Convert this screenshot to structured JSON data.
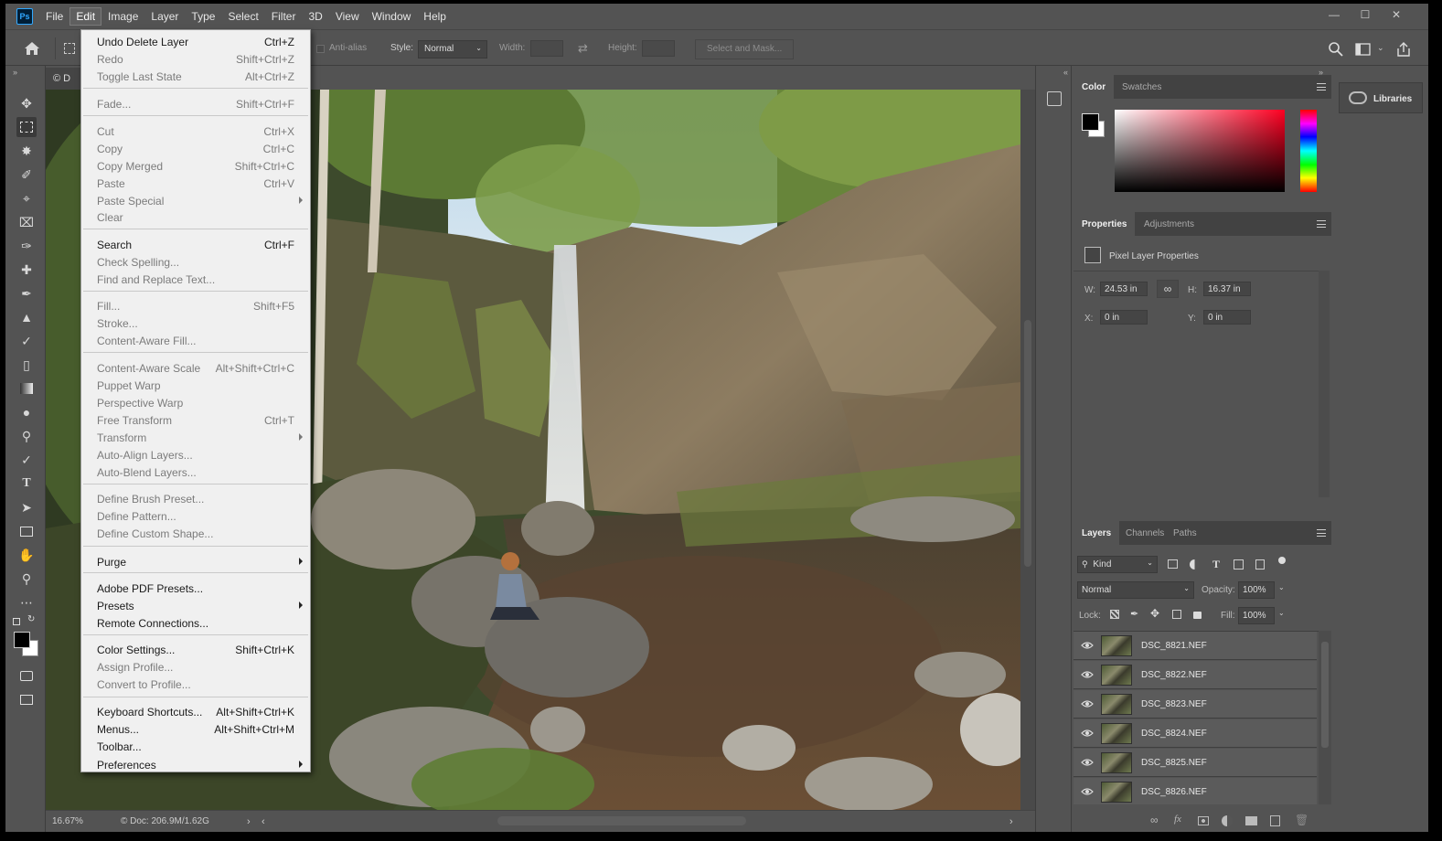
{
  "app": {
    "logo": "Ps"
  },
  "menubar": {
    "items": [
      "File",
      "Edit",
      "Image",
      "Layer",
      "Type",
      "Select",
      "Filter",
      "3D",
      "View",
      "Window",
      "Help"
    ],
    "active": "Edit"
  },
  "window_controls": [
    "minimize-icon",
    "maximize-icon",
    "close-icon"
  ],
  "options_bar": {
    "anti_alias": "Anti-alias",
    "style_label": "Style:",
    "style_value": "Normal",
    "width_label": "Width:",
    "height_label": "Height:",
    "select_mask": "Select and Mask..."
  },
  "document": {
    "tab_label": "© D"
  },
  "status": {
    "zoom": "16.67%",
    "doc": "© Doc: 206.9M/1.62G"
  },
  "edit_menu": {
    "items": [
      {
        "label": "Undo Delete Layer",
        "shortcut": "Ctrl+Z",
        "enabled": true
      },
      {
        "label": "Redo",
        "shortcut": "Shift+Ctrl+Z",
        "enabled": false
      },
      {
        "label": "Toggle Last State",
        "shortcut": "Alt+Ctrl+Z",
        "enabled": false
      },
      {
        "label": "Fade...",
        "shortcut": "Shift+Ctrl+F",
        "enabled": false
      },
      {
        "label": "Cut",
        "shortcut": "Ctrl+X",
        "enabled": false
      },
      {
        "label": "Copy",
        "shortcut": "Ctrl+C",
        "enabled": false
      },
      {
        "label": "Copy Merged",
        "shortcut": "Shift+Ctrl+C",
        "enabled": false
      },
      {
        "label": "Paste",
        "shortcut": "Ctrl+V",
        "enabled": false
      },
      {
        "label": "Paste Special",
        "shortcut": "",
        "enabled": false,
        "submenu": true
      },
      {
        "label": "Clear",
        "shortcut": "",
        "enabled": false
      },
      {
        "label": "Search",
        "shortcut": "Ctrl+F",
        "enabled": true
      },
      {
        "label": "Check Spelling...",
        "shortcut": "",
        "enabled": false
      },
      {
        "label": "Find and Replace Text...",
        "shortcut": "",
        "enabled": false
      },
      {
        "label": "Fill...",
        "shortcut": "Shift+F5",
        "enabled": false
      },
      {
        "label": "Stroke...",
        "shortcut": "",
        "enabled": false
      },
      {
        "label": "Content-Aware Fill...",
        "shortcut": "",
        "enabled": false
      },
      {
        "label": "Content-Aware Scale",
        "shortcut": "Alt+Shift+Ctrl+C",
        "enabled": false
      },
      {
        "label": "Puppet Warp",
        "shortcut": "",
        "enabled": false
      },
      {
        "label": "Perspective Warp",
        "shortcut": "",
        "enabled": false
      },
      {
        "label": "Free Transform",
        "shortcut": "Ctrl+T",
        "enabled": false
      },
      {
        "label": "Transform",
        "shortcut": "",
        "enabled": false,
        "submenu": true
      },
      {
        "label": "Auto-Align Layers...",
        "shortcut": "",
        "enabled": false
      },
      {
        "label": "Auto-Blend Layers...",
        "shortcut": "",
        "enabled": false
      },
      {
        "label": "Define Brush Preset...",
        "shortcut": "",
        "enabled": false
      },
      {
        "label": "Define Pattern...",
        "shortcut": "",
        "enabled": false
      },
      {
        "label": "Define Custom Shape...",
        "shortcut": "",
        "enabled": false
      },
      {
        "label": "Purge",
        "shortcut": "",
        "enabled": true,
        "submenu": true
      },
      {
        "label": "Adobe PDF Presets...",
        "shortcut": "",
        "enabled": true
      },
      {
        "label": "Presets",
        "shortcut": "",
        "enabled": true,
        "submenu": true
      },
      {
        "label": "Remote Connections...",
        "shortcut": "",
        "enabled": true
      },
      {
        "label": "Color Settings...",
        "shortcut": "Shift+Ctrl+K",
        "enabled": true
      },
      {
        "label": "Assign Profile...",
        "shortcut": "",
        "enabled": false
      },
      {
        "label": "Convert to Profile...",
        "shortcut": "",
        "enabled": false
      },
      {
        "label": "Keyboard Shortcuts...",
        "shortcut": "Alt+Shift+Ctrl+K",
        "enabled": true
      },
      {
        "label": "Menus...",
        "shortcut": "Alt+Shift+Ctrl+M",
        "enabled": true
      },
      {
        "label": "Toolbar...",
        "shortcut": "",
        "enabled": true
      },
      {
        "label": "Preferences",
        "shortcut": "",
        "enabled": true,
        "submenu": true
      }
    ]
  },
  "color_panel": {
    "tabs": [
      "Color",
      "Swatches"
    ],
    "foreground": "#000000",
    "background": "#ffffff",
    "hue": "#ff0022"
  },
  "libraries": {
    "label": "Libraries"
  },
  "properties_panel": {
    "tabs": [
      "Properties",
      "Adjustments"
    ],
    "title": "Pixel Layer Properties",
    "w_label": "W:",
    "w_value": "24.53 in",
    "h_label": "H:",
    "h_value": "16.37 in",
    "x_label": "X:",
    "x_value": "0 in",
    "y_label": "Y:",
    "y_value": "0 in"
  },
  "layers_panel": {
    "tabs": [
      "Layers",
      "Channels",
      "Paths"
    ],
    "filter": "Kind",
    "blend_mode": "Normal",
    "opacity_label": "Opacity:",
    "opacity": "100%",
    "lock_label": "Lock:",
    "fill_label": "Fill:",
    "fill": "100%",
    "layers": [
      "DSC_8821.NEF",
      "DSC_8822.NEF",
      "DSC_8823.NEF",
      "DSC_8824.NEF",
      "DSC_8825.NEF",
      "DSC_8826.NEF"
    ]
  }
}
